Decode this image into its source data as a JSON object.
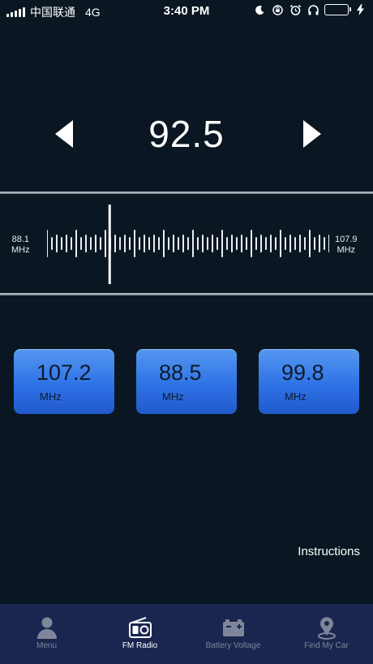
{
  "status_bar": {
    "carrier": "中国联通",
    "network": "4G",
    "time": "3:40 PM"
  },
  "radio": {
    "frequency": "92.5",
    "scale_min_value": "88.1",
    "scale_max_value": "107.9",
    "scale_unit": "MHz",
    "tuning_position": 0.222
  },
  "presets": [
    {
      "value": "107.2",
      "unit": "MHz"
    },
    {
      "value": "88.5",
      "unit": "MHz"
    },
    {
      "value": "99.8",
      "unit": "MHz"
    }
  ],
  "instructions_label": "Instructions",
  "tabs": [
    {
      "label": "Menu",
      "icon": "person-icon",
      "active": false
    },
    {
      "label": "FM Radio",
      "icon": "radio-icon",
      "active": true
    },
    {
      "label": "Battery Voltage",
      "icon": "battery-icon",
      "active": false
    },
    {
      "label": "Find My Car",
      "icon": "location-pin-icon",
      "active": false
    }
  ],
  "colors": {
    "background": "#0a1722",
    "preset_button": "#3a7ce8",
    "tab_bar": "#1b2650",
    "battery_fill": "#4cd964"
  }
}
